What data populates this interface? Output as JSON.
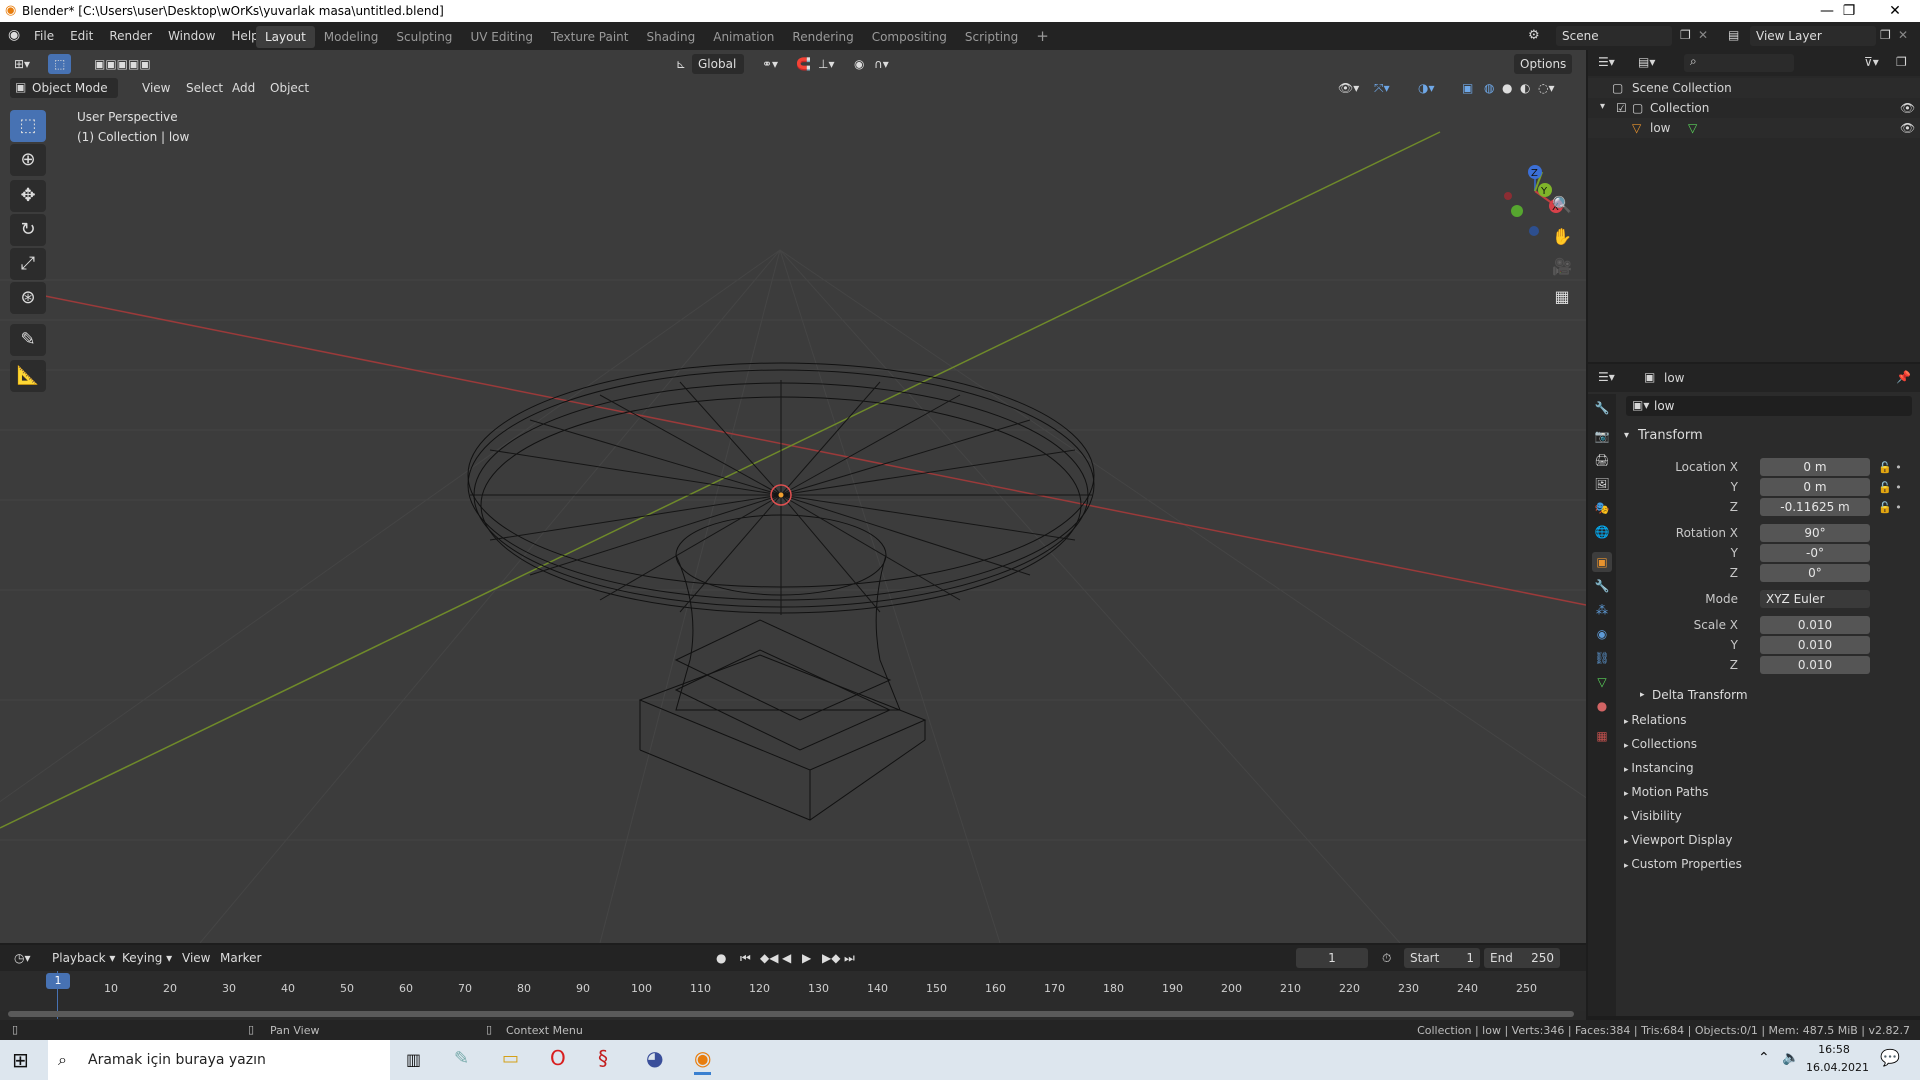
{
  "titlebar": {
    "title": "Blender* [C:\\Users\\user\\Desktop\\wOrKs\\yuvarlak masa\\untitled.blend]",
    "min": "—",
    "max": "❐",
    "close": "✕"
  },
  "menu": [
    "File",
    "Edit",
    "Render",
    "Window",
    "Help"
  ],
  "workspaces": [
    "Layout",
    "Modeling",
    "Sculpting",
    "UV Editing",
    "Texture Paint",
    "Shading",
    "Animation",
    "Rendering",
    "Compositing",
    "Scripting"
  ],
  "scene": {
    "scene_name": "Scene",
    "view_layer": "View Layer"
  },
  "viewport": {
    "mode": "Object Mode",
    "menus": [
      "View",
      "Select",
      "Add",
      "Object"
    ],
    "orientation": "Global",
    "options": "Options",
    "overlay_title": "User Perspective",
    "overlay_sub": "(1) Collection | low",
    "gizmo": {
      "x": "X",
      "y": "Y",
      "z": "Z"
    }
  },
  "outliner": {
    "root": "Scene Collection",
    "collection": "Collection",
    "object": "low"
  },
  "properties": {
    "object_name": "low",
    "data_name": "low",
    "transform": "Transform",
    "location": {
      "label": "Location X",
      "x": "0 m",
      "y": "0 m",
      "z": "-0.11625 m"
    },
    "rotation": {
      "label": "Rotation X",
      "x": "90°",
      "y": "-0°",
      "z": "0°"
    },
    "mode": {
      "label": "Mode",
      "value": "XYZ Euler"
    },
    "scale": {
      "label": "Scale X",
      "x": "0.010",
      "y": "0.010",
      "z": "0.010"
    },
    "axis_y": "Y",
    "axis_z": "Z",
    "delta": "Delta Transform",
    "sections": [
      "Relations",
      "Collections",
      "Instancing",
      "Motion Paths",
      "Visibility",
      "Viewport Display",
      "Custom Properties"
    ]
  },
  "timeline": {
    "menus": [
      "Playback",
      "Keying",
      "View",
      "Marker"
    ],
    "current": "1",
    "start_label": "Start",
    "start": "1",
    "end_label": "End",
    "end": "250",
    "ticks": [
      "1",
      "10",
      "20",
      "30",
      "40",
      "50",
      "60",
      "70",
      "80",
      "90",
      "100",
      "110",
      "120",
      "130",
      "140",
      "150",
      "160",
      "170",
      "180",
      "190",
      "200",
      "210",
      "220",
      "230",
      "240",
      "250"
    ]
  },
  "statusbar": {
    "pan": "Pan View",
    "context": "Context Menu",
    "stats": "Collection | low | Verts:346 | Faces:384 | Tris:684 | Objects:0/1 | Mem: 487.5 MiB | v2.82.7"
  },
  "taskbar": {
    "search": "Aramak için buraya yazın",
    "time": "16:58",
    "date": "16.04.2021"
  }
}
